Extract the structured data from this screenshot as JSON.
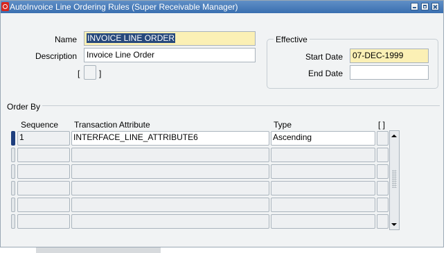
{
  "window": {
    "title": "AutoInvoice Line Ordering Rules (Super Receivable Manager)"
  },
  "icons": {
    "app": "oracle-o-icon",
    "minimize": "minimize-icon",
    "maximize": "maximize-icon",
    "close": "close-icon",
    "scroll_up": "scroll-up-arrow-icon",
    "scroll_down": "scroll-down-arrow-icon"
  },
  "form": {
    "name_label": "Name",
    "name_value": "INVOICE LINE ORDER",
    "description_label": "Description",
    "description_value": "Invoice Line Order",
    "dff_open": "[",
    "dff_close": "]"
  },
  "effective": {
    "legend": "Effective",
    "start_label": "Start Date",
    "start_value": "07-DEC-1999",
    "end_label": "End Date",
    "end_value": ""
  },
  "order_by": {
    "label": "Order By",
    "headers": {
      "sequence": "Sequence",
      "attribute": "Transaction Attribute",
      "type": "Type",
      "dff": "[ ]"
    },
    "rows": [
      {
        "sequence": "1",
        "attribute": "INTERFACE_LINE_ATTRIBUTE6",
        "type": "Ascending"
      },
      {
        "sequence": "",
        "attribute": "",
        "type": ""
      },
      {
        "sequence": "",
        "attribute": "",
        "type": ""
      },
      {
        "sequence": "",
        "attribute": "",
        "type": ""
      },
      {
        "sequence": "",
        "attribute": "",
        "type": ""
      },
      {
        "sequence": "",
        "attribute": "",
        "type": ""
      }
    ]
  },
  "colors": {
    "title_bar": "#3a6fb0",
    "required_field": "#fbf0b5",
    "selection": "#27497c",
    "current_record": "#1f3f7e",
    "window_bg": "#f1f3f4"
  }
}
